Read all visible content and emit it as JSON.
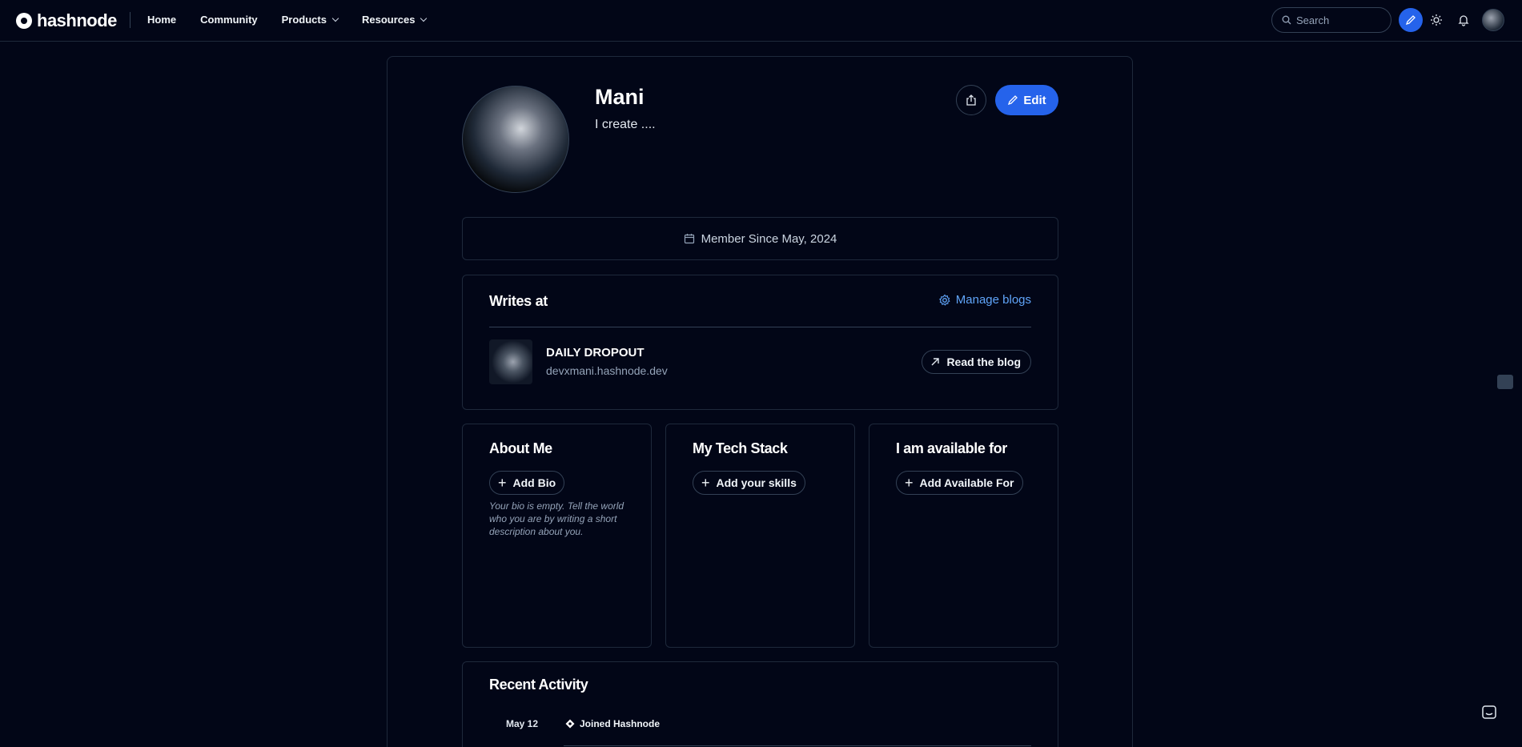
{
  "brand": {
    "name": "hashnode"
  },
  "nav": {
    "links": [
      {
        "label": "Home",
        "dropdown": false
      },
      {
        "label": "Community",
        "dropdown": false
      },
      {
        "label": "Products",
        "dropdown": true
      },
      {
        "label": "Resources",
        "dropdown": true
      }
    ],
    "search_placeholder": "Search"
  },
  "profile": {
    "name": "Mani",
    "tagline": "I create ....",
    "edit_label": "Edit",
    "member_since": "Member Since May, 2024"
  },
  "writes": {
    "title": "Writes at",
    "manage_label": "Manage blogs",
    "blog_name": "DAILY DROPOUT",
    "blog_url": "devxmani.hashnode.dev",
    "read_label": "Read the blog"
  },
  "about": {
    "title": "About Me",
    "add_label": "Add Bio",
    "empty_text": "Your bio is empty. Tell the world who you are by writing a short description about you."
  },
  "tech": {
    "title": "My Tech Stack",
    "add_label": "Add your skills"
  },
  "available": {
    "title": "I am available for",
    "add_label": "Add Available For"
  },
  "activity": {
    "title": "Recent Activity",
    "items": [
      {
        "date": "May 12",
        "text": "Joined Hashnode"
      }
    ]
  },
  "colors": {
    "background": "#020617",
    "accent": "#2563eb",
    "link": "#60a5fa",
    "border": "#1e293b"
  }
}
